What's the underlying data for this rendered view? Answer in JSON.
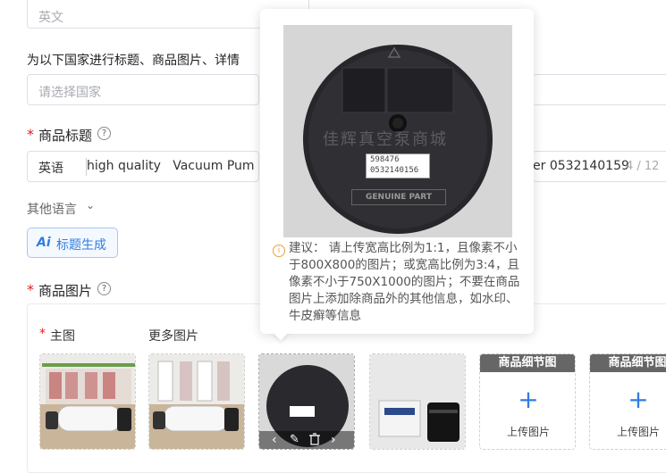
{
  "language_select": {
    "value": "英文"
  },
  "country_section": {
    "label": "为以下国家进行标题、商品图片、详情",
    "placeholder": "请选择国家"
  },
  "title_section": {
    "label": "商品标题",
    "lang_prefix": "英语",
    "value_left": "high quality   Vacuum Pum",
    "value_right": "er 0532140159",
    "counter": "4 / 12"
  },
  "other_languages": {
    "label": "其他语言"
  },
  "ai_button": {
    "icon_text": "Ai",
    "label": "标题生成"
  },
  "images_section": {
    "label": "商品图片",
    "main_label": "主图",
    "more_label": "更多图片",
    "detail_slots": [
      {
        "title": "商品细节图",
        "upload": "上传图片"
      },
      {
        "title": "商品细节图",
        "upload": "上传图片"
      }
    ]
  },
  "preview": {
    "label_code": "598476",
    "label_part": "0532140156",
    "badge": "GENUINE PART",
    "watermark": "佳辉真空泵商城"
  },
  "tip": {
    "text": "建议： 请上传宽高比例为1:1，且像素不小于800X800的图片；或宽高比例为3:4，且像素不小于750X1000的图片；不要在商品图片上添加除商品外的其他信息，如水印、牛皮癣等信息"
  },
  "colors": {
    "accent": "#2f7de1",
    "required": "#e02020",
    "tip_icon": "#e6a23c"
  },
  "icons": [
    "help-icon",
    "chevron-down-icon",
    "prev-icon",
    "edit-icon",
    "delete-icon",
    "next-icon",
    "plus-icon",
    "info-icon"
  ]
}
